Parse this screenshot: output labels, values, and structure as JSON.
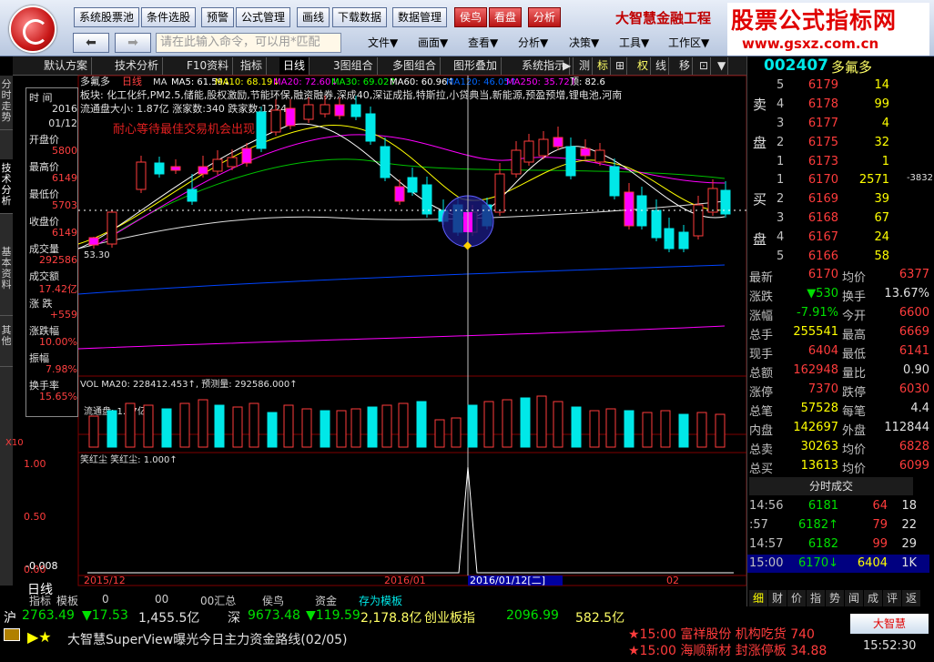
{
  "toolbar": {
    "buttons": [
      "系统股票池",
      "条件选股",
      "预警",
      "公式管理",
      "画线",
      "下载数据",
      "数据管理"
    ],
    "red_buttons": [
      "侯鸟",
      "看盘",
      "分析"
    ],
    "brand": "大智慧金融工程",
    "cmd_placeholder": "请在此输入命令，可以用*匹配",
    "menus": [
      "文件▼",
      "画面▼",
      "查看▼",
      "分析▼",
      "决策▼",
      "工具▼",
      "工作区▼"
    ]
  },
  "watermark": {
    "title": "股票公式指标网",
    "url": "www.gsxz.com.cn"
  },
  "tabs": [
    "默认方案",
    "技术分析",
    "F10资料",
    "指标",
    "日线",
    "3图组合",
    "多图组合",
    "图形叠加",
    "系统指示"
  ],
  "tools": [
    "▶",
    "测",
    "标",
    "⊞",
    "权",
    "线",
    "移",
    "⊡",
    "▼"
  ],
  "left_tabs": [
    "分时走势",
    "技术分析",
    "基本资料",
    "其他"
  ],
  "info": {
    "items": [
      [
        "时 间",
        "2016"
      ],
      [
        "",
        "01/12"
      ],
      [
        "开盘价",
        "5800"
      ],
      [
        "最高价",
        "6149"
      ],
      [
        "最低价",
        "5703"
      ],
      [
        "收盘价",
        "6149"
      ],
      [
        "成交量",
        "292586"
      ],
      [
        "成交额",
        "17.42亿"
      ],
      [
        "涨 跌",
        "+559"
      ],
      [
        "涨跌幅",
        "10.00%"
      ],
      [
        "振幅",
        "7.98%"
      ],
      [
        "换手率",
        "15.65%"
      ]
    ]
  },
  "chart": {
    "title": "多氟多",
    "period": "日线",
    "ma": [
      {
        "t": "MA",
        "c": "#e0e0e0"
      },
      {
        "t": "MA5: 61.59↓",
        "c": "#ffffff"
      },
      {
        "t": "MA10: 68.19↓",
        "c": "#ffff00"
      },
      {
        "t": "MA20: 72.60↓",
        "c": "#ff00ff"
      },
      {
        "t": "MA30: 69.02↑",
        "c": "#00ff00"
      },
      {
        "t": "MA60: 60.96↑",
        "c": "#ffffff"
      },
      {
        "t": "MA120: 46.05↑",
        "c": "#0066ff"
      },
      {
        "t": "MA250: 35.72↑",
        "c": "#ff00ff"
      },
      {
        "t": "顶: 82.6",
        "c": "#ffffff"
      }
    ],
    "sector": "板块: 化工化纤,PM2.5,储能,股权激励,节能环保,融资融券,深成40,深证成指,特斯拉,小贷典当,新能源,预盈预增,锂电池,河南",
    "float": "流通盘大小: 1.87亿  涨家数:340  跌家数:1224",
    "note": "耐心等待最佳交易机会出现",
    "low": "53.30",
    "vol_title": "VOL MA20: 228412.453↑, 预测量: 292586.000↑",
    "vol_float": "流通盘: 1.87亿",
    "vol_mult": "X10",
    "osc_title": "笑红尘  笑红尘: 1.000↑",
    "osc_left": "-0.008",
    "osc_axis": [
      "1.00",
      "0.50",
      "0.00"
    ],
    "date_cursor": "2016/01/12[二]",
    "dates": [
      "2015/12",
      "2016/01",
      "02"
    ]
  },
  "chart_data": {
    "type": "bar",
    "title": "多氟多 日线",
    "categories": [
      "2015/12",
      "2016/01",
      "2016/01/12",
      "02"
    ],
    "values": [
      1,
      0.5,
      0
    ],
    "ylim": [
      0,
      1
    ],
    "xlabel": "",
    "ylabel": ""
  },
  "quote": {
    "code": "002407",
    "name": "多氟多",
    "sell": [
      [
        "5",
        "6179",
        "14"
      ],
      [
        "4",
        "6178",
        "99"
      ],
      [
        "3",
        "6177",
        "4"
      ],
      [
        "2",
        "6175",
        "32"
      ],
      [
        "1",
        "6173",
        "1"
      ]
    ],
    "buy": [
      [
        "1",
        "6170",
        "2571",
        "-3832"
      ],
      [
        "2",
        "6169",
        "39",
        ""
      ],
      [
        "3",
        "6168",
        "67",
        ""
      ],
      [
        "4",
        "6167",
        "24",
        ""
      ],
      [
        "5",
        "6166",
        "58",
        ""
      ]
    ],
    "stats": [
      [
        "最新",
        "6170",
        "均价",
        "6377"
      ],
      [
        "涨跌",
        "▼530",
        "换手",
        "13.67%"
      ],
      [
        "涨幅",
        "-7.91%",
        "今开",
        "6600"
      ],
      [
        "总手",
        "255541",
        "最高",
        "6669"
      ],
      [
        "现手",
        "6404",
        "最低",
        "6141"
      ],
      [
        "总额",
        "162948",
        "量比",
        "0.90"
      ],
      [
        "涨停",
        "7370",
        "跌停",
        "6030"
      ],
      [
        "总笔",
        "57528",
        "每笔",
        "4.4"
      ],
      [
        "内盘",
        "142697",
        "外盘",
        "112844"
      ],
      [
        "总卖",
        "30263",
        "均价",
        "6828"
      ],
      [
        "总买",
        "13613",
        "均价",
        "6099"
      ]
    ],
    "ticks_title": "分时成交",
    "ticks": [
      [
        "14:56",
        "6181",
        "64",
        "18"
      ],
      [
        ":57",
        "6182↑",
        "79",
        "22"
      ],
      [
        "14:57",
        "6182",
        "99",
        "29"
      ],
      [
        "15:00",
        "6170↓",
        "6404",
        "1K"
      ]
    ],
    "bottom_tabs": [
      "细",
      "财",
      "价",
      "指",
      "势",
      "闻",
      "成",
      "评",
      "返"
    ]
  },
  "bottom_tabs": [
    "指标",
    "模板",
    "0",
    "00",
    "00汇总",
    "侯鸟",
    "资金",
    "存为模板"
  ],
  "status": {
    "market": "沪",
    "sh": "2763.49",
    "sh_chg": "▼17.53",
    "sh_amt": "1,455.5亿",
    "sz_label": "深",
    "sz": "9673.48",
    "sz_chg": "▼119.59",
    "sz_amt": "2,178.8亿",
    "cy_label": "创业板指",
    "cy": "2096.99",
    "cy_amt": "582.5亿",
    "news": "大智慧SuperView曝光今日主力资金路线(02/05)",
    "alerts": [
      "★15:00 富祥股份 机构吃货 740",
      "★15:00 海顺新材 封涨停板 34.88"
    ],
    "time": "15:52:30",
    "logo": "大智慧"
  },
  "colors": {
    "up": "#ff3c3c",
    "down": "#00e8e8",
    "bg": "#000000"
  }
}
